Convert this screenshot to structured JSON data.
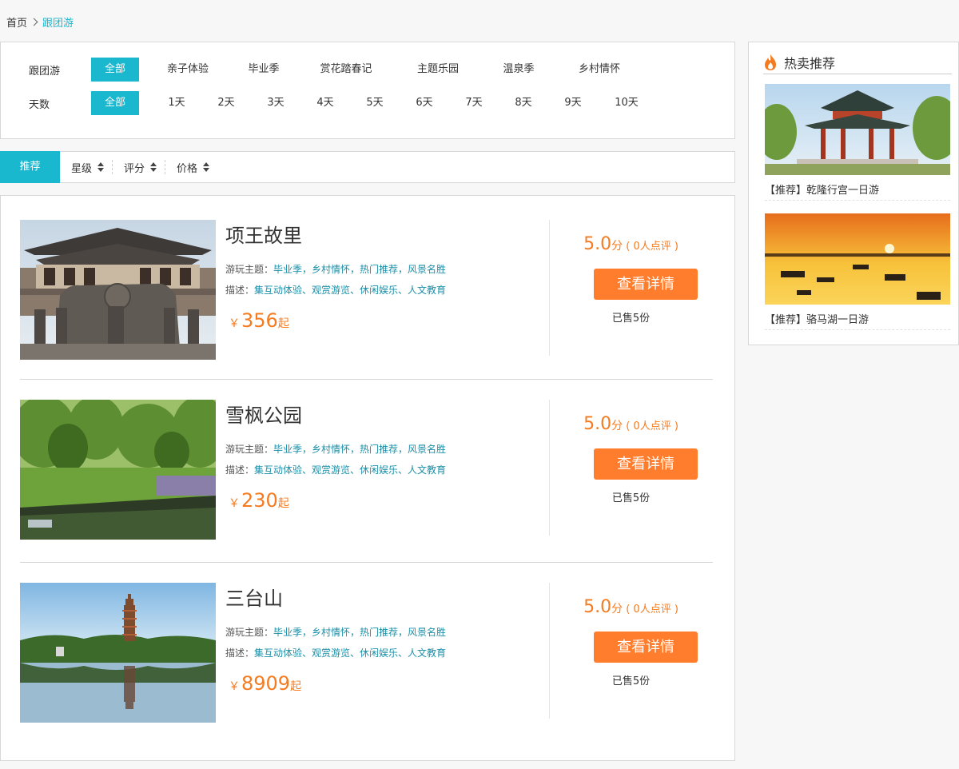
{
  "breadcrumb": {
    "home": "首页",
    "current": "跟团游"
  },
  "filters": {
    "row1": {
      "label": "跟团游",
      "options": [
        "全部",
        "亲子体验",
        "毕业季",
        "赏花踏春记",
        "主题乐园",
        "温泉季",
        "乡村情怀"
      ]
    },
    "row2": {
      "label": "天数",
      "options": [
        "全部",
        "1天",
        "2天",
        "3天",
        "4天",
        "5天",
        "6天",
        "7天",
        "8天",
        "9天",
        "10天"
      ]
    }
  },
  "sort": {
    "recommend": "推荐",
    "items": [
      "星级",
      "评分",
      "价格"
    ]
  },
  "products": [
    {
      "name": "项王故里",
      "theme_label": "游玩主题：",
      "theme": "毕业季，乡村情怀，热门推荐，风景名胜",
      "desc_label": "描述：",
      "desc": "集互动体验、观赏游览、休闲娱乐、人文教育",
      "currency": "￥",
      "price": "356",
      "suffix": "起",
      "score": "5.0",
      "score_unit": "分",
      "reviews": "( 0人点评 )",
      "button": "查看详情",
      "sold": "已售5份"
    },
    {
      "name": "雪枫公园",
      "theme_label": "游玩主题：",
      "theme": "毕业季，乡村情怀，热门推荐，风景名胜",
      "desc_label": "描述：",
      "desc": "集互动体验、观赏游览、休闲娱乐、人文教育",
      "currency": "￥",
      "price": "230",
      "suffix": "起",
      "score": "5.0",
      "score_unit": "分",
      "reviews": "( 0人点评 )",
      "button": "查看详情",
      "sold": "已售5份"
    },
    {
      "name": "三台山",
      "theme_label": "游玩主题：",
      "theme": "毕业季，乡村情怀，热门推荐，风景名胜",
      "desc_label": "描述：",
      "desc": "集互动体验、观赏游览、休闲娱乐、人文教育",
      "currency": "￥",
      "price": "8909",
      "suffix": "起",
      "score": "5.0",
      "score_unit": "分",
      "reviews": "( 0人点评 )",
      "button": "查看详情",
      "sold": "已售5份"
    }
  ],
  "sidebar": {
    "title": "热卖推荐",
    "icon": "flame-icon",
    "items": [
      {
        "caption": "【推荐】乾隆行宫一日游"
      },
      {
        "caption": "【推荐】骆马湖一日游"
      }
    ]
  },
  "colors": {
    "accent": "#1ab8cf",
    "orange": "#f47b20",
    "button": "#ff7d2c"
  }
}
